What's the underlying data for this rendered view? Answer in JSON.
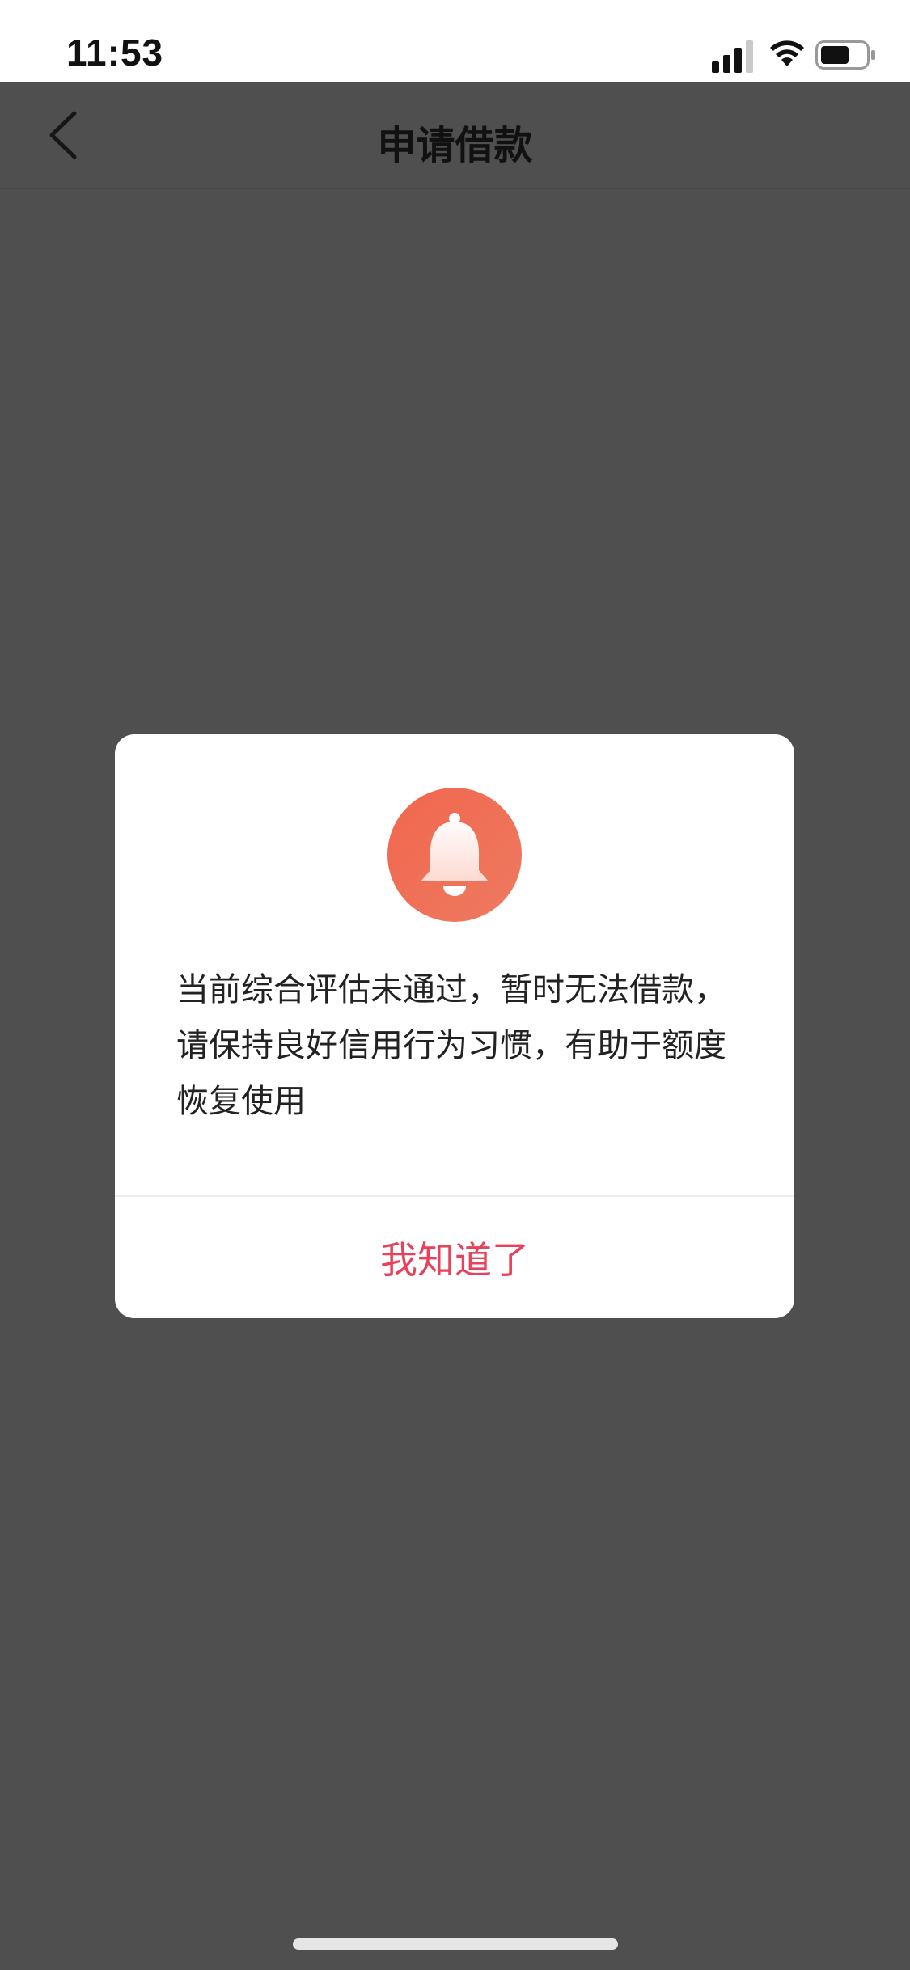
{
  "status_bar": {
    "time": "11:53",
    "icons": [
      "signal-icon",
      "wifi-icon",
      "battery-icon"
    ]
  },
  "nav": {
    "back_icon": "chevron-left-icon",
    "title": "申请借款"
  },
  "dialog": {
    "icon": "bell-icon",
    "message": "当前综合评估未通过，暂时无法借款，请保持良好信用行为习惯，有助于额度恢复使用",
    "confirm_label": "我知道了"
  },
  "colors": {
    "overlay": "#4f4f4f",
    "accent": "#e8415a",
    "badge": "#f0674e"
  }
}
